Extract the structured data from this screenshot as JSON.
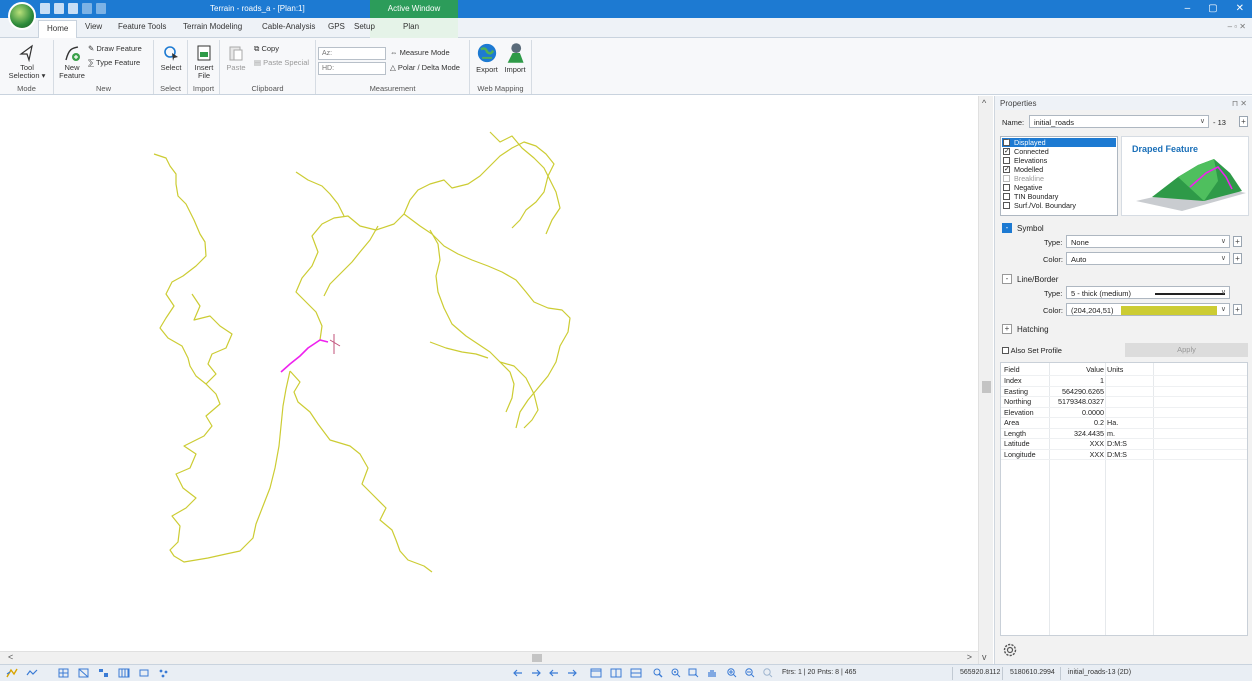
{
  "titlebar": {
    "title": "Terrain - roads_a - [Plan:1]",
    "active_window": "Active Window",
    "minimize": "–",
    "restore": "▢",
    "close": "✕"
  },
  "tabs": [
    "Home",
    "View",
    "Feature Tools",
    "Terrain Modeling",
    "Cable-Analysis",
    "GPS",
    "Setup",
    "Plan"
  ],
  "mdi_controls": "– ▫ ✕",
  "ribbon": {
    "mode": {
      "tool_selection": "Tool Selection ▾",
      "label": "Mode"
    },
    "new": {
      "new_feature": "New Feature",
      "draw_feature": "Draw Feature",
      "type_feature": "Type Feature",
      "label": "New"
    },
    "select": {
      "select": "Select",
      "label": "Select"
    },
    "import": {
      "insert_file": "Insert File",
      "label": "Import"
    },
    "clipboard": {
      "paste": "Paste",
      "copy": "Copy",
      "paste_special": "Paste Special",
      "label": "Clipboard"
    },
    "measurement": {
      "az": "Az:",
      "hd": "HD:",
      "measure_mode": "Measure Mode",
      "polar_delta": "Polar / Delta Mode",
      "label": "Measurement"
    },
    "web_mapping": {
      "export": "Export",
      "import": "Import",
      "label": "Web Mapping"
    }
  },
  "properties": {
    "header": "Properties",
    "header_ctrls": "⊓ ✕",
    "name_label": "Name:",
    "name_value": "initial_roads",
    "name_index": "- 13",
    "flags": [
      {
        "label": "Displayed",
        "checked": true,
        "selected": true
      },
      {
        "label": "Connected",
        "checked": true
      },
      {
        "label": "Elevations",
        "checked": false
      },
      {
        "label": "Modelled",
        "checked": true
      },
      {
        "label": "Breakline",
        "checked": false,
        "disabled": true
      },
      {
        "label": "Negative",
        "checked": false
      },
      {
        "label": "TIN Boundary",
        "checked": false
      },
      {
        "label": "Surf./Vol. Boundary",
        "checked": false
      }
    ],
    "preview_title": "Draped Feature",
    "symbol": {
      "title": "Symbol",
      "type_label": "Type:",
      "type_value": "None",
      "color_label": "Color:",
      "color_value": "Auto"
    },
    "line_border": {
      "title": "Line/Border",
      "type_label": "Type:",
      "type_value": "5 - thick (medium)",
      "color_label": "Color:",
      "color_value": "(204,204,51)",
      "color_hex": "#cccc33"
    },
    "hatching": {
      "title": "Hatching"
    },
    "also_set_profile": "Also Set Profile",
    "apply": "Apply",
    "table": {
      "headers": [
        "Field",
        "Value",
        "Units"
      ],
      "rows": [
        [
          "Index",
          "1",
          ""
        ],
        [
          "Easting",
          "564290.6265",
          ""
        ],
        [
          "Northing",
          "5179348.0327",
          ""
        ],
        [
          "Elevation",
          "0.0000",
          ""
        ],
        [
          "Area",
          "0.2",
          "Ha."
        ],
        [
          "Length",
          "324.4435",
          "m."
        ],
        [
          "Latitude",
          "XXX",
          "D:M:S"
        ],
        [
          "Longitude",
          "XXX",
          "D:M:S"
        ]
      ]
    }
  },
  "statusbar": {
    "counts": "Ftrs: 1 | 20  Pnts: 8 | 465",
    "easting": "565920.8112",
    "northing": "5180610.2994",
    "feature": "initial_roads-13 (2D)"
  },
  "colors": {
    "road": "#cccc33",
    "selected_road": "#ee22ee",
    "accent": "#1d7ad2"
  }
}
